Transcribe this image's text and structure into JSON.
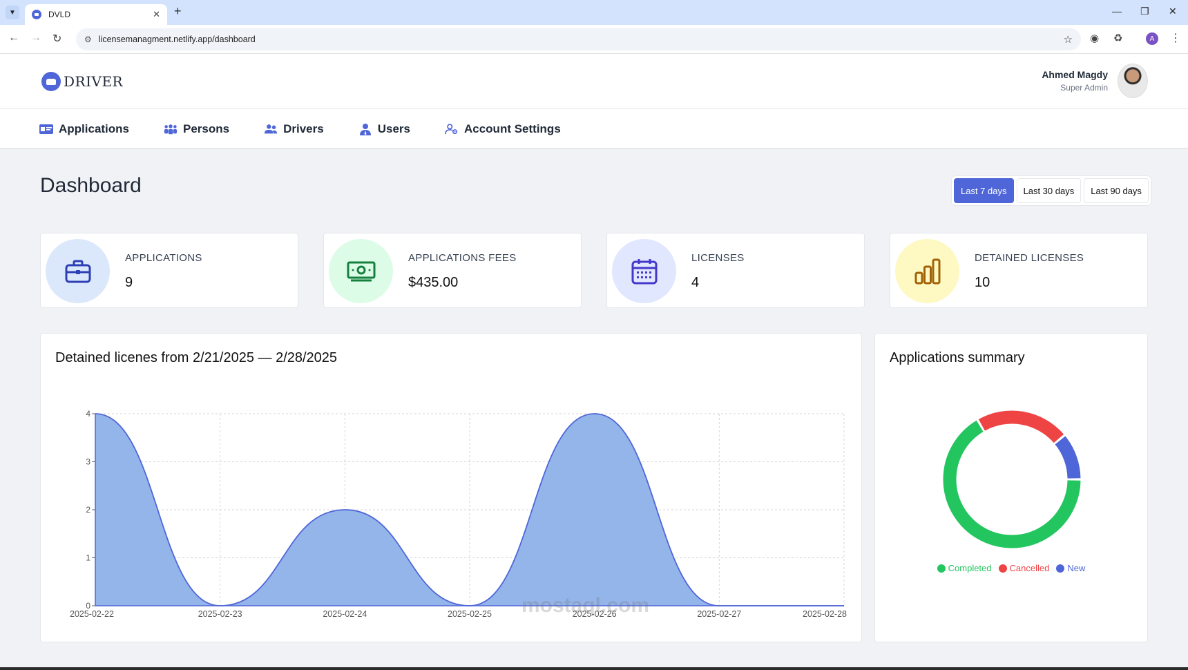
{
  "browser": {
    "tab_title": "DVLD",
    "url": "licensemanagment.netlify.app/dashboard",
    "profile_initial": "A"
  },
  "header": {
    "logo_text": "DRIVER",
    "user_name": "Ahmed Magdy",
    "user_role": "Super Admin"
  },
  "nav": {
    "items": [
      {
        "label": "Applications",
        "icon": "id-card-icon"
      },
      {
        "label": "Persons",
        "icon": "people-group-icon"
      },
      {
        "label": "Drivers",
        "icon": "users-icon"
      },
      {
        "label": "Users",
        "icon": "user-tie-icon"
      },
      {
        "label": "Account Settings",
        "icon": "user-gear-icon"
      }
    ]
  },
  "page": {
    "title": "Dashboard",
    "ranges": [
      "Last 7 days",
      "Last 30 days",
      "Last 90 days"
    ],
    "active_range": "Last 7 days"
  },
  "stats": [
    {
      "label": "APPLICATIONS",
      "value": "9",
      "icon": "briefcase-icon",
      "bg": "#dbe8fb",
      "color": "#2d3fb4"
    },
    {
      "label": "APPLICATIONS FEES",
      "value": "$435.00",
      "icon": "money-bill-icon",
      "bg": "#dcfce7",
      "color": "#15803d"
    },
    {
      "label": "LICENSES",
      "value": "4",
      "icon": "calendar-icon",
      "bg": "#e0e7ff",
      "color": "#4338ca"
    },
    {
      "label": "DETAINED LICENSES",
      "value": "10",
      "icon": "bar-chart-icon",
      "bg": "#fef9c3",
      "color": "#a16207"
    }
  ],
  "area_panel": {
    "title": "Detained licenes from 2/21/2025 — 2/28/2025"
  },
  "donut_panel": {
    "title": "Applications summary"
  },
  "chart_data": [
    {
      "type": "area",
      "title": "Detained licenes from 2/21/2025 — 2/28/2025",
      "x": [
        "2025-02-22",
        "2025-02-23",
        "2025-02-24",
        "2025-02-25",
        "2025-02-26",
        "2025-02-27",
        "2025-02-28"
      ],
      "values": [
        4,
        0,
        2,
        0,
        4,
        0,
        0
      ],
      "ylim": [
        0,
        4
      ],
      "yticks": [
        "0",
        "1",
        "2",
        "3",
        "4"
      ],
      "grid": true,
      "fill": "#93b5ea",
      "stroke": "#4f66d8"
    },
    {
      "type": "pie",
      "donut": true,
      "categories": [
        "Completed",
        "Cancelled",
        "New"
      ],
      "values": [
        6,
        2,
        1
      ],
      "colors": [
        "#22c55e",
        "#ef4444",
        "#4f66d8"
      ],
      "legend": "bottom"
    }
  ],
  "watermark": "mostaql.com"
}
